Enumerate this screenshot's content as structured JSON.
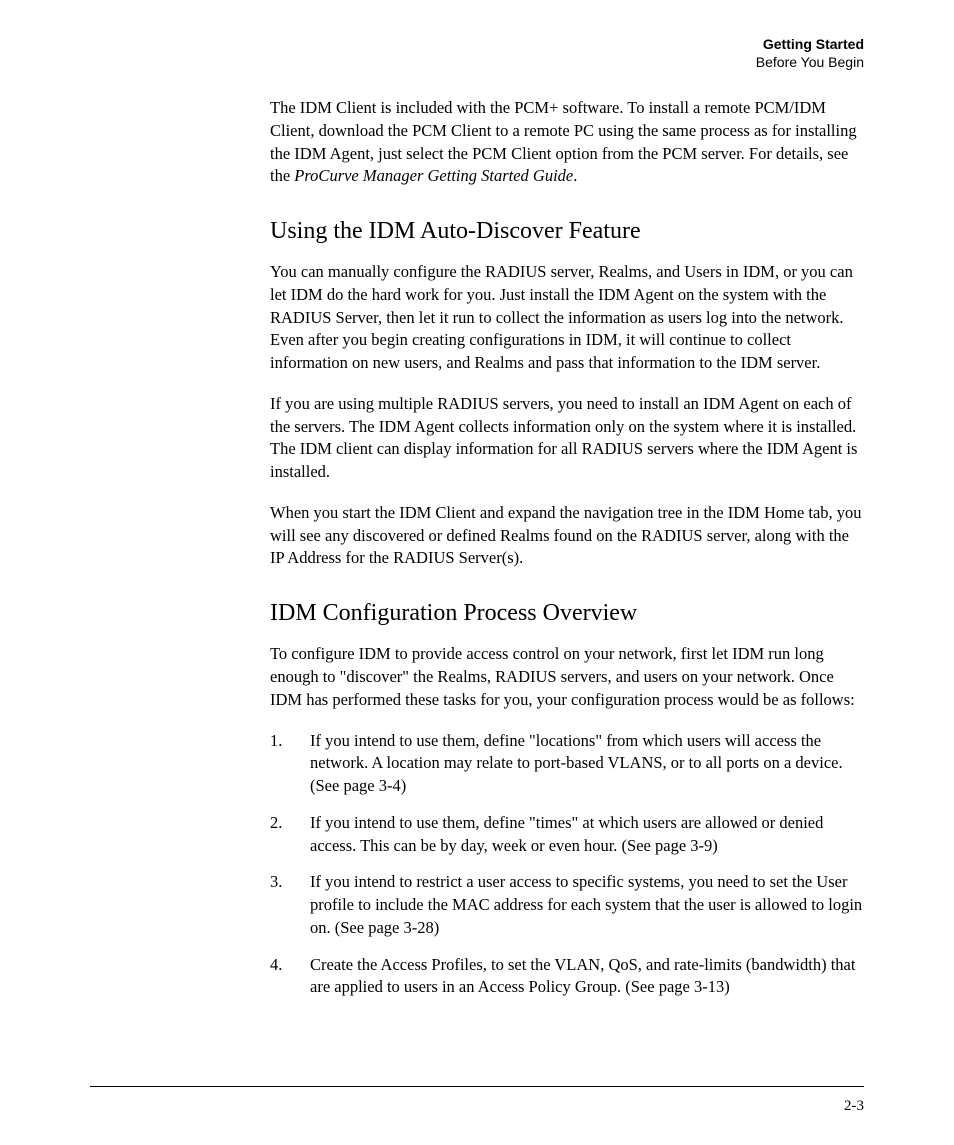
{
  "header": {
    "chapter": "Getting Started",
    "section": "Before You Begin"
  },
  "intro": {
    "text_before_italic": "The IDM Client is included with the PCM+ software. To install a remote PCM/IDM Client, download the PCM Client to a remote PC using the same process as for installing the IDM Agent, just select the PCM Client option from the PCM server. For details, see the ",
    "italic": "ProCurve Manager Getting Started Guide",
    "text_after_italic": "."
  },
  "section1": {
    "heading": "Using the IDM Auto-Discover Feature",
    "p1": "You can manually configure the RADIUS server, Realms, and Users in IDM, or you can let IDM do the hard work for you. Just install the IDM Agent on the system with the RADIUS Server, then let it run to collect the information as users log into the network. Even after you begin creating configurations in IDM, it will continue to collect information on new users, and Realms and pass that information to the IDM server.",
    "p2": "If you are using multiple RADIUS servers, you need to install an IDM Agent on each of the servers. The IDM Agent collects information only on the system where it is installed. The IDM client can display information for all RADIUS servers where the IDM Agent is installed.",
    "p3": "When you start the IDM Client and expand the navigation tree in the IDM Home tab, you will see any discovered or defined Realms found on the RADIUS server, along with the IP Address for the RADIUS Server(s)."
  },
  "section2": {
    "heading": "IDM Configuration Process Overview",
    "p1": "To configure IDM to provide access control on your network, first let IDM run long enough to \"discover\" the Realms, RADIUS servers, and users on your network. Once IDM has performed these tasks for you, your configuration process would be as follows:",
    "steps": [
      "If you intend to use them, define \"locations\" from which users will access the network. A location may relate to port-based VLANS, or to all ports on a device. (See page 3-4)",
      "If you intend to use them, define \"times\" at which users are allowed or denied access. This can be by day, week or even hour. (See page 3-9)",
      "If you intend to restrict a user access to specific systems, you need to set the User profile to include the MAC address for each system that the user is allowed to login on. (See page 3-28)",
      "Create the Access Profiles, to set the VLAN, QoS, and rate-limits (bandwidth) that are applied to users in an Access Policy Group. (See page 3-13)"
    ]
  },
  "footer": {
    "page_number": "2-3"
  }
}
